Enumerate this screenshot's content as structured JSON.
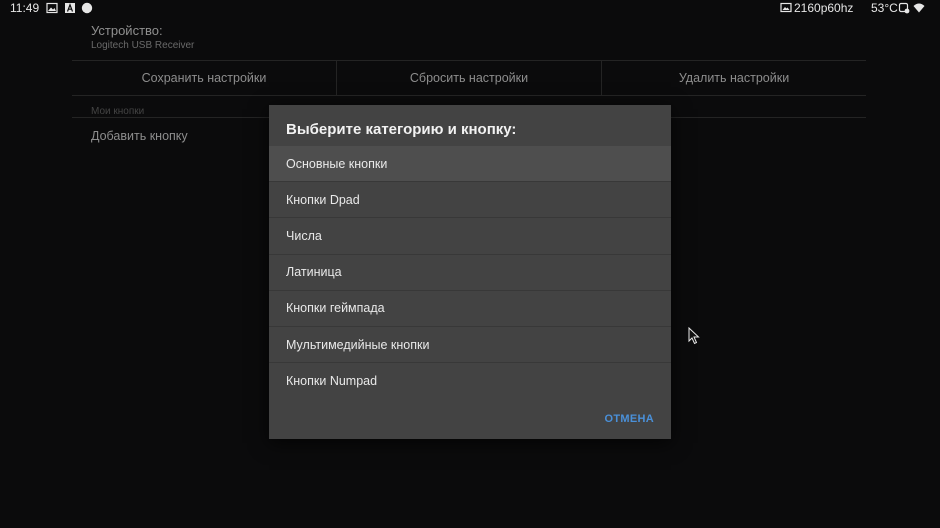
{
  "statusbar": {
    "time": "11:49",
    "left_icons": [
      "image-icon",
      "font-icon",
      "circle-icon"
    ],
    "resolution": "2160p60hz",
    "temperature": "53°C",
    "right_icons": [
      "display-icon",
      "settings-icon",
      "wifi-icon"
    ]
  },
  "settings": {
    "device_label": "Устройство:",
    "device_name": "Logitech USB Receiver",
    "buttons": {
      "save": "Сохранить настройки",
      "reset": "Сбросить настройки",
      "delete": "Удалить настройки"
    },
    "my_buttons_label": "Мои кнопки",
    "add_button": "Добавить кнопку"
  },
  "dialog": {
    "title": "Выберите категорию и кнопку:",
    "items": [
      "Основные кнопки",
      "Кнопки Dpad",
      "Числа",
      "Латиница",
      "Кнопки геймпада",
      "Мультимедийные кнопки",
      "Кнопки Numpad"
    ],
    "selected_index": 0,
    "cancel": "ОТМЕНА"
  },
  "colors": {
    "background": "#0b0b0c",
    "dialog": "#434343",
    "accent": "#4a90d9"
  }
}
